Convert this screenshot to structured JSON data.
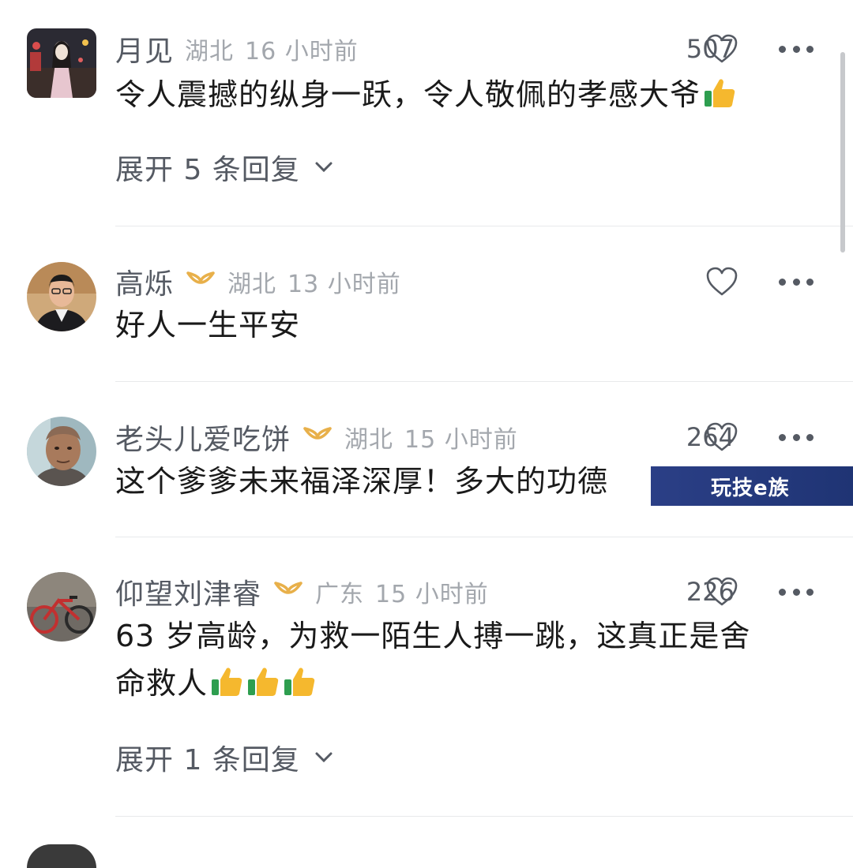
{
  "comments": [
    {
      "username": "月见",
      "location": "湖北",
      "time": "16 小时前",
      "likes": "507",
      "text": "令人震撼的纵身一跃，令人敬佩的孝感大爷",
      "text_emoji": "thumbs-up-icon",
      "expand_label": "展开 5 条回复",
      "has_vip_badge": false
    },
    {
      "username": "高烁",
      "location": "湖北",
      "time": "13 小时前",
      "likes": "",
      "text": "好人一生平安",
      "has_vip_badge": true
    },
    {
      "username": "老头儿爱吃饼",
      "location": "湖北",
      "time": "15 小时前",
      "likes": "264",
      "text": "这个爹爹未来福泽深厚！多大的功德",
      "has_vip_badge": true
    },
    {
      "username": "仰望刘津睿",
      "location": "广东",
      "time": "15 小时前",
      "likes": "226",
      "text_line1": "63 岁高龄，为救一陌生人搏一跳，这真正是舍",
      "text_line2": "命救人",
      "text_emoji": "thumbs-up-icon",
      "expand_label": "展开 1 条回复",
      "has_vip_badge": true
    }
  ],
  "watermark": "玩技e族",
  "colors": {
    "name": "#555a63",
    "meta": "#a3a7ad",
    "text": "#1a1a1a",
    "vip_badge": "#e8b04a",
    "banner": "#2b3f86"
  }
}
